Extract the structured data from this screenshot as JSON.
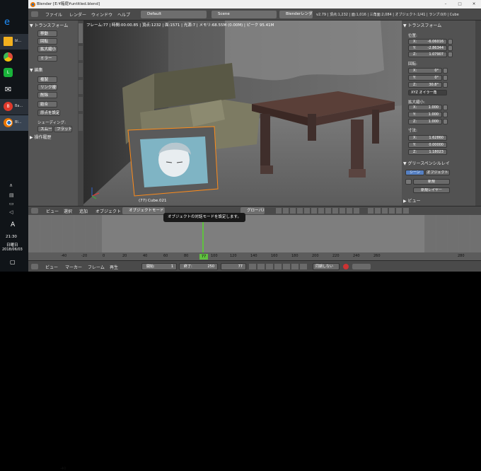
{
  "taskbar": {
    "items": [
      {
        "label": "",
        "color": "#1e90ff",
        "glyph": "e"
      },
      {
        "label": "bl...",
        "color": "#f2b01e",
        "glyph": ""
      },
      {
        "label": "",
        "color": "#dd4b39",
        "glyph": ""
      },
      {
        "label": "",
        "color": "#19b33a",
        "glyph": "L"
      },
      {
        "label": "",
        "color": "#ffffff",
        "glyph": "✉"
      },
      {
        "label": "Ba...",
        "color": "#e0392b",
        "glyph": "B"
      },
      {
        "label": "Bl...",
        "color": "#ea7600",
        "glyph": ""
      }
    ],
    "ime": "A",
    "time": "21:30",
    "weekday": "日曜日",
    "date": "2018/06/03"
  },
  "window": {
    "title": "Blender [E:¥箱庭¥untitled.blend]"
  },
  "menubar": {
    "menus": [
      "ファイル",
      "レンダー",
      "ウィンドウ",
      "ヘルプ"
    ],
    "layout_value": "Default",
    "scene_value": "Scene",
    "engine_value": "Blenderレンダー",
    "stats": "v2.79 | 頂点:1,232 | 面:1,016 | 三角面:2,084 | オブジェクト:1/41 | ランプ:0/0 | Cube"
  },
  "toolshelf": {
    "transform_header": "▼ トランスフォーム",
    "transform_buttons": [
      "移動",
      "回転",
      "拡大縮小",
      "ミラー"
    ],
    "edit_header": "▼ 編集",
    "edit_buttons": [
      "複製",
      "リンク複製",
      "削除",
      "結合"
    ],
    "origin_value": "原点を設定",
    "shading_label": "シェーディング:",
    "smooth_label": "スムー",
    "flat_label": "フラット",
    "history_header": "▶ 操作履歴",
    "tabs": [
      "ツール",
      "作成",
      "関係",
      "アニメ",
      "物理",
      "グリース"
    ]
  },
  "viewport": {
    "info": "フレーム:77 | 時間:00:00.85 | 頂点:1232 | 面:1571 | 光源:7 | メモリ:68.55M (0.00M) | ピーク 95.41M",
    "object_label": "(77) Cube.021"
  },
  "properties": {
    "transform_header": "▼ トランスフォーム",
    "location_label": "位置:",
    "location": [
      {
        "k": "X:",
        "v": "-6.06016"
      },
      {
        "k": "Y:",
        "v": "-2.86344"
      },
      {
        "k": "Z:",
        "v": "1.07907"
      }
    ],
    "rotation_label": "回転:",
    "rotation": [
      {
        "k": "X:",
        "v": "0°"
      },
      {
        "k": "Y:",
        "v": "0°"
      },
      {
        "k": "Z:",
        "v": "30.8°"
      }
    ],
    "rotation_mode": "XYZ オイラー角",
    "scale_label": "拡大縮小:",
    "scale": [
      {
        "k": "X:",
        "v": "1.000"
      },
      {
        "k": "Y:",
        "v": "1.000"
      },
      {
        "k": "Z:",
        "v": "1.000"
      }
    ],
    "dimensions_label": "寸法:",
    "dimensions": [
      {
        "k": "X:",
        "v": "1.62860"
      },
      {
        "k": "Y:",
        "v": "0.00000"
      },
      {
        "k": "Z:",
        "v": "1.18023"
      }
    ],
    "grease_header": "▼ グリースペンシルレイ",
    "scene_btn": "シーン",
    "object_btn": "オブジェクト",
    "new_btn": "新規",
    "new_layer_btn": "新規レイヤー",
    "view_header": "▶ ビュー"
  },
  "viewport_header": {
    "menus": [
      "ビュー",
      "選択",
      "追加",
      "オブジェクト"
    ],
    "mode_value": "オブジェクトモード",
    "pivot_value": "グローバル"
  },
  "tooltip": "オブジェクトの対話モードを設定します。",
  "timeline": {
    "current_frame": "77",
    "ticks": [
      "-40",
      "-20",
      "0",
      "20",
      "40",
      "60",
      "80",
      "100",
      "120",
      "140",
      "160",
      "180",
      "200",
      "220",
      "240",
      "260",
      "280"
    ],
    "menus": [
      "ビュー",
      "マーカー",
      "フレーム",
      "再生"
    ],
    "start_label": "開始:",
    "start_value": "1",
    "end_label": "終了:",
    "end_value": "250",
    "frame_value": "77",
    "sync_value": "同期しない"
  }
}
